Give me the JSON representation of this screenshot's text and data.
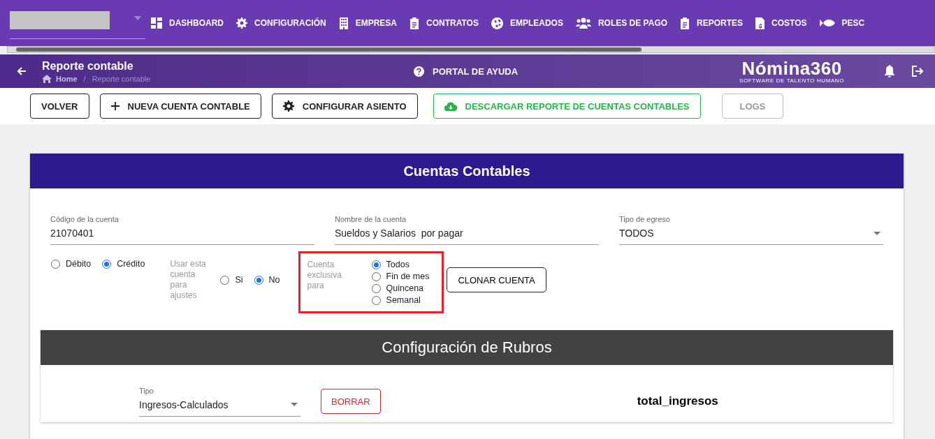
{
  "nav": {
    "items": [
      {
        "label": "DASHBOARD"
      },
      {
        "label": "CONFIGURACIÓN"
      },
      {
        "label": "EMPRESA"
      },
      {
        "label": "CONTRATOS"
      },
      {
        "label": "EMPLEADOS"
      },
      {
        "label": "ROLES DE PAGO"
      },
      {
        "label": "REPORTES"
      },
      {
        "label": "COSTOS"
      },
      {
        "label": "PESC"
      }
    ]
  },
  "header": {
    "title": "Reporte contable",
    "breadcrumb_separator": "/",
    "breadcrumb": [
      {
        "label": "Home",
        "current": false
      },
      {
        "label": "Reporte contable",
        "current": true
      }
    ],
    "help": "PORTAL DE AYUDA",
    "logo": "Nómina360",
    "tagline": "SOFTWARE DE TALENTO HUMANO"
  },
  "toolbar": [
    {
      "label": "VOLVER",
      "kind": "default",
      "disabled": false
    },
    {
      "label": "NUEVA CUENTA CONTABLE",
      "kind": "default",
      "disabled": false
    },
    {
      "label": "CONFIGURAR ASIENTO",
      "kind": "default",
      "disabled": false
    },
    {
      "label": "DESCARGAR REPORTE DE CUENTAS CONTABLES",
      "kind": "success",
      "disabled": false
    },
    {
      "label": "LOGS",
      "kind": "default",
      "disabled": true
    }
  ],
  "card": {
    "title": "Cuentas Contables",
    "fields": [
      {
        "label": "Código de la cuenta",
        "value": "21070401",
        "kind": "text"
      },
      {
        "label": "Nombre de la cuenta",
        "value": "Sueldos y Salarios  por pagar",
        "kind": "text"
      },
      {
        "label": "Tipo de egreso",
        "value": "TODOS",
        "kind": "select"
      }
    ],
    "radio_groups": [
      {
        "options": [
          {
            "label": "Débito",
            "selected": false
          },
          {
            "label": "Crédito",
            "selected": true
          }
        ],
        "highlighted": false
      },
      {
        "label": "Usar esta cuenta para ajustes",
        "options": [
          {
            "label": "Si",
            "selected": false
          },
          {
            "label": "No",
            "selected": true
          }
        ],
        "highlighted": false
      },
      {
        "label": "Cuenta exclusiva para",
        "options": [
          {
            "label": "Todos",
            "selected": true
          },
          {
            "label": "Fin de mes",
            "selected": false
          },
          {
            "label": "Quincena",
            "selected": false
          },
          {
            "label": "Semanal",
            "selected": false
          }
        ],
        "highlighted": true
      }
    ],
    "clone_button": "CLONAR CUENTA"
  },
  "rubros": {
    "title": "Configuración de Rubros",
    "tipo": {
      "label": "Tipo",
      "value": "Ingresos-Calculados"
    },
    "delete_button": "BORRAR",
    "name": "total_ingresos"
  }
}
